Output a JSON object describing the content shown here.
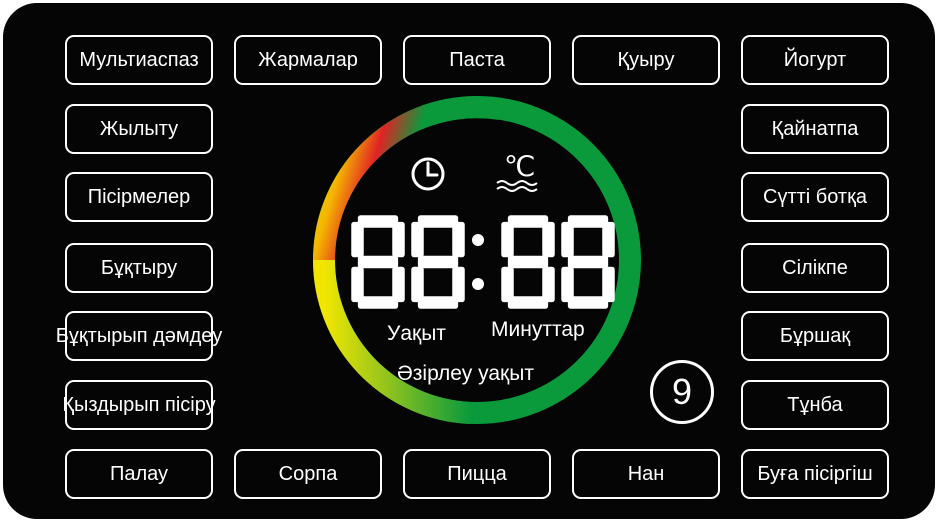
{
  "buttons": {
    "multicooker": "Мультиаспаз",
    "frying": "Жармалар",
    "pasta": "Паста",
    "roasting": "Қуыру",
    "yogurt": "Йогурт",
    "warming": "Жылыту",
    "boiling": "Қайнатпа",
    "baking": "Пісірмелер",
    "milk_porridge": "Сүтті ботқа",
    "stewing": "Бұқтыру",
    "jelly": "Сілікпе",
    "braise_flavor": "Бұқтырып дәмдеу",
    "beans": "Бұршақ",
    "heat_cook": "Қыздырып пісіру",
    "clarify": "Тұнба",
    "pilaf": "Палау",
    "soup": "Сорпа",
    "pizza": "Пицца",
    "bread": "Нан",
    "steamer": "Буға пісіргіш"
  },
  "display": {
    "digits": "88:88",
    "time_label": "Уақыт",
    "minutes_label": "Минуттар",
    "ready_time_label": "Әзірлеу уақыт",
    "temperature_unit": "℃",
    "clock_icon": "clock-icon",
    "temperature_icon": "temperature-water-icon"
  },
  "badge": {
    "number": "9"
  },
  "colors": {
    "panel": "#050505",
    "ring_green": "#0a9a3c",
    "ring_yellow": "#f2e600",
    "ring_red": "#e02424",
    "segment": "#ffffff"
  }
}
